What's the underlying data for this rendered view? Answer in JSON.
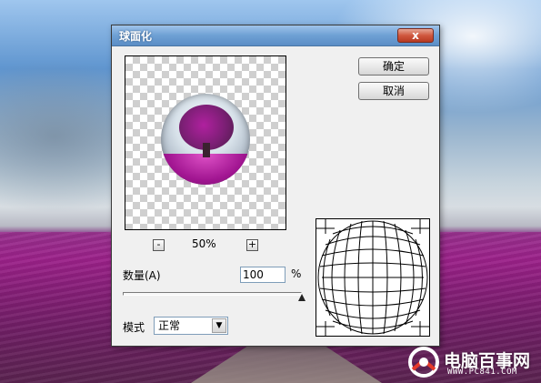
{
  "window": {
    "title": "球面化",
    "close_label": "x"
  },
  "buttons": {
    "ok_label": "确定",
    "cancel_label": "取消"
  },
  "zoom": {
    "minus_label": "-",
    "plus_label": "+",
    "level": "50%"
  },
  "amount": {
    "label": "数量(A)",
    "value": "100",
    "unit": "%"
  },
  "slider": {
    "value_fraction": 1.0
  },
  "mode": {
    "label": "模式",
    "selected": "正常",
    "arrow_icon": "chevron-down-icon"
  },
  "watermark": {
    "brand": "电脑百事网",
    "url": "WWW.PC841.COM"
  },
  "colors": {
    "titlebar": "#6ea0d4",
    "close_button": "#d0583f",
    "dialog_bg": "#f0f0f0"
  }
}
